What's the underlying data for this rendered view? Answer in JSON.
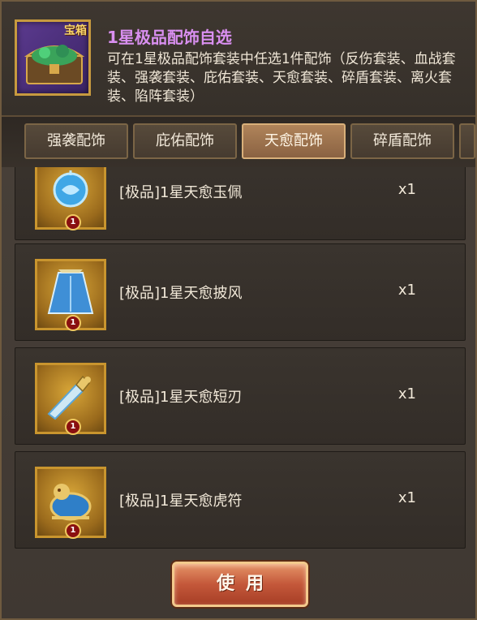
{
  "chest": {
    "tag": "宝箱",
    "icon": "treasure-chest-icon"
  },
  "header": {
    "title": "1星极品配饰自选",
    "description": "可在1星极品配饰套装中任选1件配饰（反伤套装、血战套装、强袭套装、庇佑套装、天愈套装、碎盾套装、离火套装、陷阵套装）",
    "title_color": "#d98ff0"
  },
  "tabs": [
    {
      "label": "强袭配饰",
      "active": false
    },
    {
      "label": "庇佑配饰",
      "active": false
    },
    {
      "label": "天愈配饰",
      "active": true
    },
    {
      "label": "碎盾配饰",
      "active": false
    }
  ],
  "items": [
    {
      "name": "[极品]1星天愈玉佩",
      "qty": "x1",
      "star": "1",
      "icon": "jade-pendant-icon"
    },
    {
      "name": "[极品]1星天愈披风",
      "qty": "x1",
      "star": "1",
      "icon": "cape-icon"
    },
    {
      "name": "[极品]1星天愈短刃",
      "qty": "x1",
      "star": "1",
      "icon": "dagger-icon"
    },
    {
      "name": "[极品]1星天愈虎符",
      "qty": "x1",
      "star": "1",
      "icon": "tiger-tally-icon"
    }
  ],
  "use_button": {
    "label": "使用"
  }
}
